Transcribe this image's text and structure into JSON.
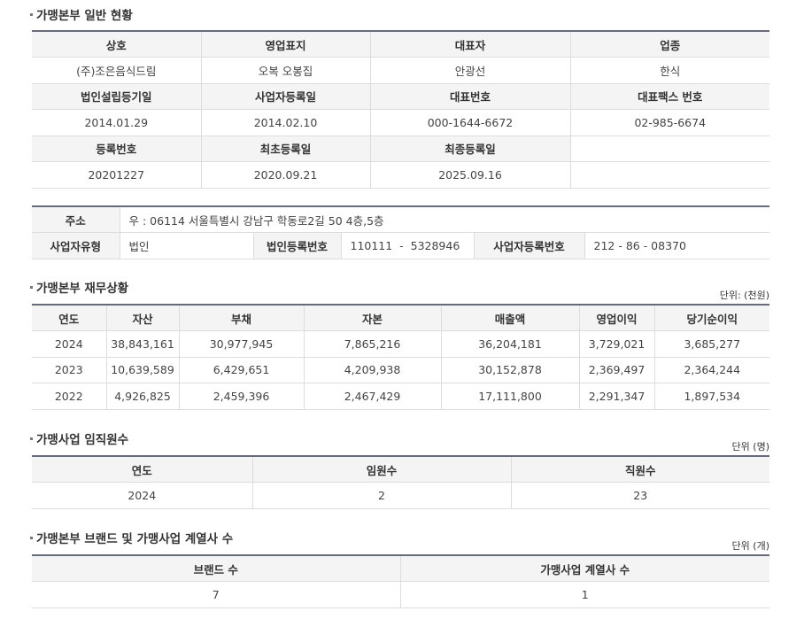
{
  "general": {
    "title": "가맹본부 일반 현황",
    "rows": [
      {
        "type": "head",
        "cells": [
          "상호",
          "영업표지",
          "대표자",
          "업종"
        ]
      },
      {
        "type": "data",
        "cells": [
          "(주)조은음식드림",
          "오복 오봉집",
          "안광선",
          "한식"
        ]
      },
      {
        "type": "head",
        "cells": [
          "법인설립등기일",
          "사업자등록일",
          "대표번호",
          "대표팩스 번호"
        ]
      },
      {
        "type": "data",
        "cells": [
          "2014.01.29",
          "2014.02.10",
          "000-1644-6672",
          "02-985-6674"
        ]
      },
      {
        "type": "head",
        "cells": [
          "등록번호",
          "최초등록일",
          "최종등록일",
          ""
        ]
      },
      {
        "type": "data",
        "cells": [
          "20201227",
          "2020.09.21",
          "2025.09.16",
          ""
        ]
      }
    ]
  },
  "address": {
    "label": "주소",
    "value": "우 : 06114 서울특별시 강남구 학동로2길 50 4층,5층",
    "biz_type_label": "사업자유형",
    "biz_type_value": "법인",
    "corp_reg_label": "법인등록번호",
    "corp_reg_value": "110111  -  5328946",
    "biz_reg_label": "사업자등록번호",
    "biz_reg_value": "212 - 86 - 08370"
  },
  "finance": {
    "title": "가맹본부 재무상황",
    "unit": "단위: (천원)",
    "headers": [
      "연도",
      "자산",
      "부채",
      "자본",
      "매출액",
      "영업이익",
      "당기순이익"
    ],
    "rows": [
      [
        "2024",
        "38,843,161",
        "30,977,945",
        "7,865,216",
        "36,204,181",
        "3,729,021",
        "3,685,277"
      ],
      [
        "2023",
        "10,639,589",
        "6,429,651",
        "4,209,938",
        "30,152,878",
        "2,369,497",
        "2,364,244"
      ],
      [
        "2022",
        "4,926,825",
        "2,459,396",
        "2,467,429",
        "17,111,800",
        "2,291,347",
        "1,897,534"
      ]
    ]
  },
  "staff": {
    "title": "가맹사업 임직원수",
    "unit": "단위 (명)",
    "headers": [
      "연도",
      "임원수",
      "직원수"
    ],
    "rows": [
      [
        "2024",
        "2",
        "23"
      ]
    ]
  },
  "brands": {
    "title": "가맹본부 브랜드 및 가맹사업 계열사 수",
    "unit": "단위 (개)",
    "headers": [
      "브랜드 수",
      "가맹사업 계열사 수"
    ],
    "rows": [
      [
        "7",
        "1"
      ]
    ]
  }
}
